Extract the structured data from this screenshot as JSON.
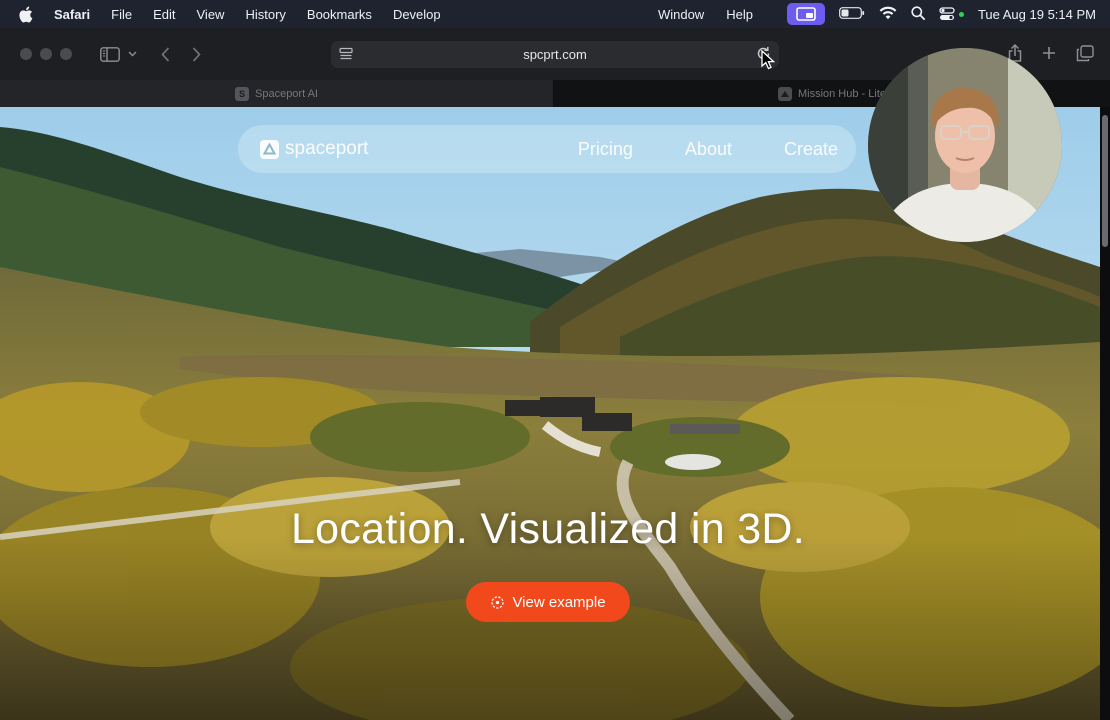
{
  "menubar": {
    "app_name": "Safari",
    "menus": [
      "File",
      "Edit",
      "View",
      "History",
      "Bookmarks",
      "Develop"
    ],
    "right_menus": [
      "Window",
      "Help"
    ],
    "clock": "Tue Aug 19  5:14 PM",
    "icons": [
      "apple-icon",
      "screen-recording-icon",
      "battery-icon",
      "wifi-icon",
      "search-icon",
      "control-center-icon"
    ]
  },
  "toolbar": {
    "url": "spcprt.com",
    "icons": [
      "sidebar-icon",
      "chevron-down-icon",
      "back-icon",
      "forward-icon",
      "page-menu-icon",
      "reload-icon",
      "share-icon",
      "new-tab-icon",
      "tab-overview-icon"
    ]
  },
  "tabs": [
    {
      "title": "Spaceport AI",
      "favicon": "S",
      "active": true
    },
    {
      "title": "Mission Hub - Lite",
      "favicon": "",
      "active": false
    }
  ],
  "site": {
    "brand": "spaceport",
    "nav": [
      "Pricing",
      "About",
      "Create"
    ],
    "headline": "Location. Visualized in 3D.",
    "cta_label": "View example",
    "accent_color": "#f2491c"
  }
}
